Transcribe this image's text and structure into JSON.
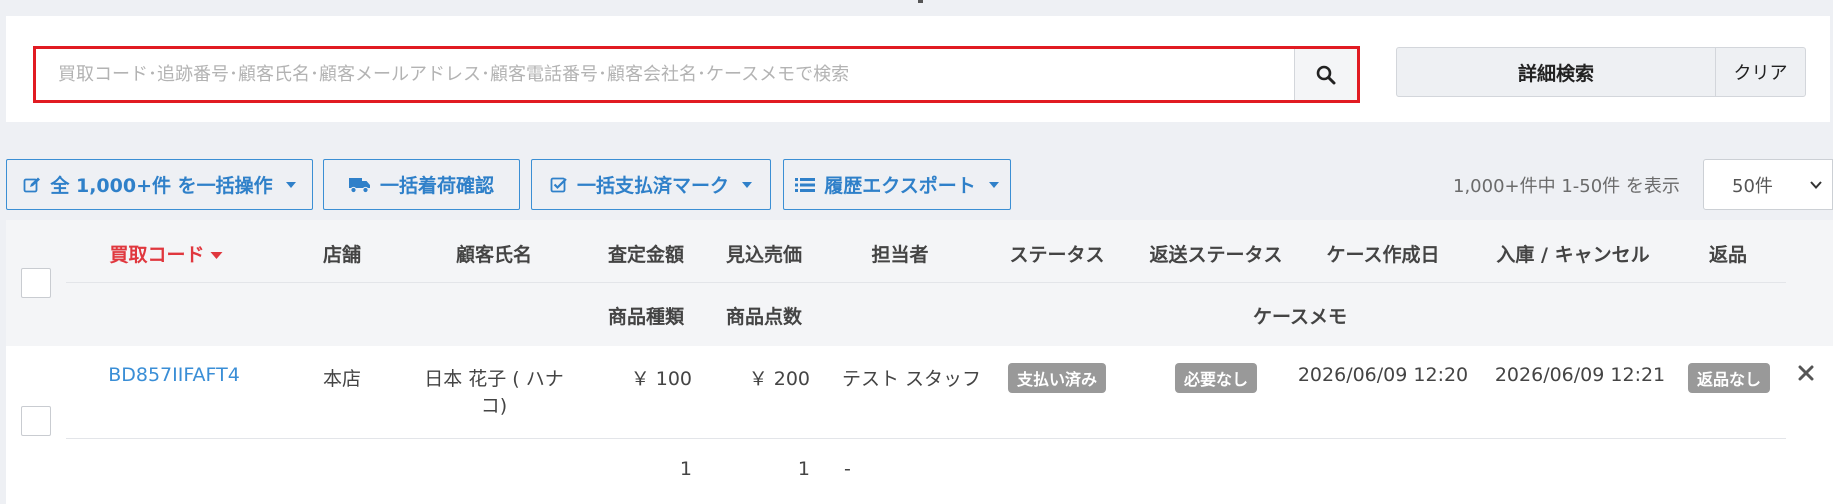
{
  "search": {
    "placeholder": "買取コード･追跡番号･顧客氏名･顧客メールアドレス･顧客電話番号･顧客会社名･ケースメモで検索",
    "search_icon": "search-icon",
    "detail_label": "詳細検索",
    "clear_label": "クリア"
  },
  "toolbar": {
    "bulk_all_label": "全 1,000+件 を一括操作",
    "arrival_label": "一括着荷確認",
    "paid_label": "一括支払済マーク",
    "export_label": "履歴エクスポート",
    "count_text": "1,000+件中 1-50件 を表示",
    "per_page": "50件"
  },
  "table": {
    "headers": {
      "code": "買取コード",
      "store": "店舗",
      "customer": "顧客氏名",
      "assessed": "査定金額",
      "expected": "見込売価",
      "staff": "担当者",
      "status": "ステータス",
      "return_status": "返送ステータス",
      "created": "ケース作成日",
      "stock": "入庫 / キャンセル",
      "returned": "返品",
      "item_types": "商品種類",
      "item_count": "商品点数",
      "memo": "ケースメモ"
    },
    "rows": [
      {
        "code": "BD857IIFAFT4",
        "store": "本店",
        "customer_line1": "日本 花子 ( ハナ",
        "customer_line2": "コ)",
        "assessed": "￥ 100",
        "expected": "￥ 200",
        "staff": "テスト スタッフ",
        "status": "支払い済み",
        "return_status": "必要なし",
        "created": "2026/06/09 12:20",
        "stock": "2026/06/09 12:21",
        "returned": "返品なし",
        "item_types": "1",
        "item_count": "1",
        "memo": "-"
      }
    ]
  },
  "colors": {
    "accent_blue": "#2f80c9",
    "sort_red": "#e0373e",
    "highlight_red": "#e11b22",
    "badge_gray": "#999999"
  }
}
